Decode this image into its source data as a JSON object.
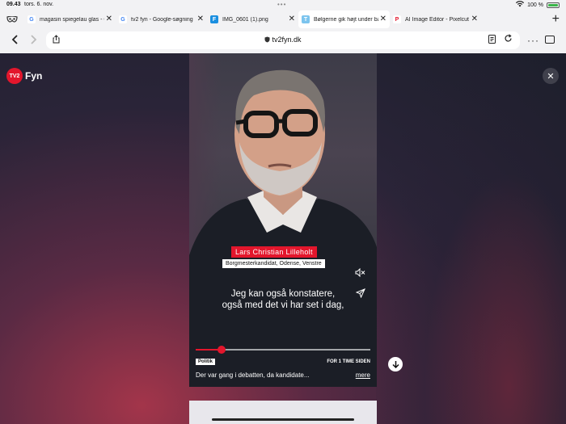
{
  "status": {
    "time": "09.43",
    "date": "tors. 6. nov.",
    "battery": "100 %"
  },
  "tabs": [
    {
      "label": "magasin spiegelau glas - G",
      "favicon": "G",
      "color": "#ffffff",
      "text_color": "#4285f4"
    },
    {
      "label": "tv2 fyn - Google-søgning",
      "favicon": "G",
      "color": "#ffffff",
      "text_color": "#4285f4"
    },
    {
      "label": "IMG_0601 (1).png",
      "favicon": "F",
      "color": "#1a8fe0",
      "text_color": "#ffffff"
    },
    {
      "label": "Bølgerne gik højt under ba",
      "favicon": "T",
      "color": "#7cc4ee",
      "text_color": "#ffffff",
      "active": true
    },
    {
      "label": "AI Image Editor - Pixelcut",
      "favicon": "P",
      "color": "#ffffff",
      "text_color": "#e3162c"
    }
  ],
  "address": {
    "url": "tv2fyn.dk"
  },
  "logo": {
    "mark": "TV2",
    "name": "Fyn"
  },
  "video": {
    "person_name": "Lars Christian Lilleholt",
    "person_role": "Borgmesterkandidat, Odense, Venstre",
    "subtitle_line1": "Jeg kan også konstatere,",
    "subtitle_line2": "også med det vi har set i dag,",
    "progress": 0.15,
    "tag": "Politik",
    "time_ago": "FOR 1 TIME SIDEN",
    "description": "Der var gang i debatten, da kandidate...",
    "more": "mere"
  },
  "icons": {
    "tabs_overview": "mask-icon",
    "back": "chevron-left-icon",
    "forward": "chevron-right-icon",
    "share": "share-icon",
    "reader": "document-icon",
    "reload": "reload-icon",
    "more": "ellipsis-icon",
    "sidebar": "sidebar-icon",
    "close": "close-icon",
    "mute": "mute-icon",
    "send": "send-icon",
    "scroll_down": "arrow-down-icon"
  },
  "colors": {
    "brand_red": "#e3162c"
  }
}
